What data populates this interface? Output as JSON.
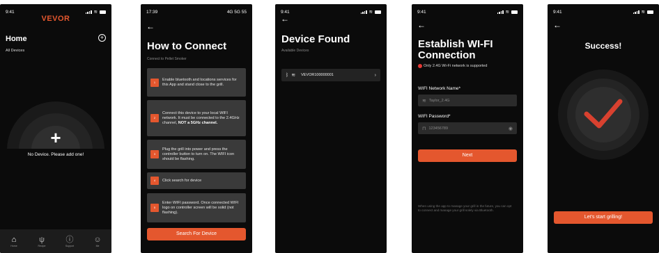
{
  "colors": {
    "accent": "#e4572e",
    "background": "#0b0b0b",
    "card": "#3a3a3a",
    "warning": "#e53935"
  },
  "screen1": {
    "time": "9:41",
    "logo": "VEVOR",
    "title": "Home",
    "subtitle": "All Devices",
    "empty_message": "No Device. Please add one!",
    "tabs": [
      {
        "label": "Home",
        "icon": "home-icon"
      },
      {
        "label": "Recipe",
        "icon": "fork-knife-icon"
      },
      {
        "label": "Support",
        "icon": "question-icon"
      },
      {
        "label": "Me",
        "icon": "user-icon"
      }
    ]
  },
  "screen2": {
    "time": "17:39",
    "status_right": "4G 5G 55",
    "title": "How to Connect",
    "subtitle": "Connect to Pellet Smoker",
    "steps": [
      {
        "num": "1",
        "text": "Enable bluetooth and locations services for this App and stand close to the grill."
      },
      {
        "num": "2",
        "text": "Connect this device to your local WIFI network. It must be connected to the 2.4GHz channel,",
        "bold": "NOT a 5GHz channel."
      },
      {
        "num": "3",
        "text": "Plug the grill into power and press the controller button to turn on. The WIFI icon should be flashing."
      },
      {
        "num": "4",
        "text": "Click search for device"
      },
      {
        "num": "5",
        "text": "Enter WIFI password. Once connected WIFI logo on controller screen will be solid (not flashing)."
      }
    ],
    "button": "Search For Device"
  },
  "screen3": {
    "time": "9:41",
    "title": "Device Found",
    "subtitle": "Available Devices",
    "device_name": "VEVOR100000001"
  },
  "screen4": {
    "time": "9:41",
    "title_line1": "Establish WI-FI",
    "title_line2": "Connection",
    "warning": "Only 2.4G Wi-Fi network is supported",
    "network_label": "WIFI Network Name*",
    "network_value": "Taylor_2.4G",
    "password_label": "WIFI Password*",
    "password_value": "123456789",
    "button": "Next",
    "hint": "When using the app to manage your grill in the future, you can opt to connect and manage your grill solely via Bluetooth."
  },
  "screen5": {
    "time": "9:41",
    "title": "Success!",
    "button": "Let's start grilling!"
  }
}
